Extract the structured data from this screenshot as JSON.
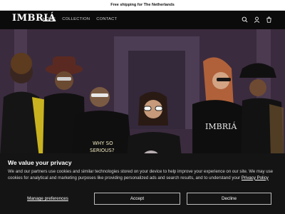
{
  "announcement": {
    "text": "Free shipping for The Netherlands"
  },
  "header": {
    "logo": "IMBRIÁ",
    "nav": [
      "HOME",
      "COLLECTION",
      "CONTACT"
    ],
    "icons": [
      "search-icon",
      "account-icon",
      "cart-icon"
    ]
  },
  "hero": {
    "shirt_text_1": "WHY SO",
    "shirt_text_2": "SERIOUS?",
    "shirt_text_3": "IMBRIÁ"
  },
  "cookie": {
    "title": "We value your privacy",
    "body": "We and our partners use cookies and similar technologies stored on your device to help improve your experience on our site. We may use cookies for analytical and marketing purposes like providing personalized ads and search results, and to understand your",
    "policy_link": "Privacy Policy",
    "manage_label": "Manage preferences",
    "accept_label": "Accept",
    "decline_label": "Decline"
  },
  "colors": {
    "header_bg": "#0b0b0b",
    "banner_bg": "#141414"
  }
}
